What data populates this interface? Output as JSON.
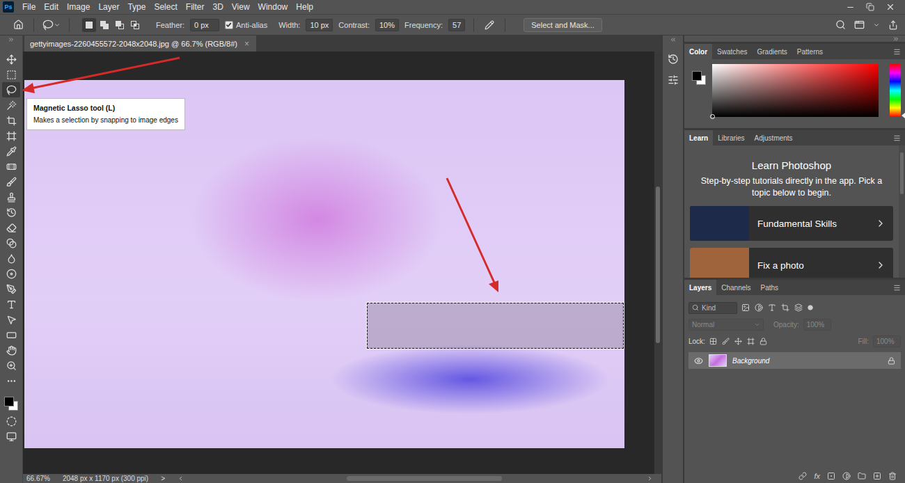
{
  "app": {
    "logo": "Ps"
  },
  "menu": [
    "File",
    "Edit",
    "Image",
    "Layer",
    "Type",
    "Select",
    "Filter",
    "3D",
    "View",
    "Window",
    "Help"
  ],
  "options_bar": {
    "selection_modes": [
      {
        "kind": "new",
        "selected": true
      },
      {
        "kind": "add",
        "selected": false
      },
      {
        "kind": "subtract",
        "selected": false
      },
      {
        "kind": "intersect",
        "selected": false
      }
    ],
    "feather": {
      "label": "Feather:",
      "value": "0 px"
    },
    "anti_alias": {
      "label": "Anti-alias",
      "checked": true
    },
    "settings": [
      {
        "label": "Width:",
        "value": "10 px"
      },
      {
        "label": "Contrast:",
        "value": "10%"
      },
      {
        "label": "Frequency:",
        "value": "57"
      }
    ],
    "select_and_mask": "Select and Mask..."
  },
  "tools": [
    {
      "kind": "move",
      "selected": false
    },
    {
      "kind": "marquee",
      "selected": false
    },
    {
      "kind": "lasso",
      "selected": true
    },
    {
      "kind": "wand",
      "selected": false
    },
    {
      "kind": "crop",
      "selected": false
    },
    {
      "kind": "frame",
      "selected": false
    },
    {
      "kind": "eyedropper",
      "selected": false
    },
    {
      "kind": "healing",
      "selected": false
    },
    {
      "kind": "brush",
      "selected": false
    },
    {
      "kind": "stamp",
      "selected": false
    },
    {
      "kind": "history-brush",
      "selected": false
    },
    {
      "kind": "eraser",
      "selected": false
    },
    {
      "kind": "gradient",
      "selected": false
    },
    {
      "kind": "blur",
      "selected": false
    },
    {
      "kind": "dodge",
      "selected": false
    },
    {
      "kind": "pen",
      "selected": false
    },
    {
      "kind": "type",
      "selected": false
    },
    {
      "kind": "path-select",
      "selected": false
    },
    {
      "kind": "shape",
      "selected": false
    },
    {
      "kind": "hand",
      "selected": false
    },
    {
      "kind": "zoom",
      "selected": false
    },
    {
      "kind": "more",
      "selected": false
    },
    {
      "kind": "colors",
      "selected": false
    },
    {
      "kind": "quick-mask",
      "selected": false
    },
    {
      "kind": "screen-mode",
      "selected": false
    }
  ],
  "tooltip": {
    "title": "Magnetic Lasso tool (L)",
    "description": "Makes a selection by snapping to image edges"
  },
  "document": {
    "tab_title": "gettyimages-2260455572-2048x2048.jpg @ 66.7% (RGB/8#)",
    "close": "×",
    "selection_active": true
  },
  "scrollbars": {
    "vertical": {
      "offset": 0.32,
      "level": 0.37
    },
    "horizontal": {
      "offset": 0.35,
      "level": 0.34
    }
  },
  "status_bar": {
    "zoom": "66.67%",
    "info": "2048 px x 1170 px (300 ppi)",
    "more": ">"
  },
  "color_panel": {
    "tabs": [
      {
        "label": "Color",
        "selected": true
      },
      {
        "label": "Swatches",
        "selected": false
      },
      {
        "label": "Gradients",
        "selected": false
      },
      {
        "label": "Patterns",
        "selected": false
      }
    ]
  },
  "learn_panel": {
    "tabs": [
      {
        "label": "Learn",
        "selected": true
      },
      {
        "label": "Libraries",
        "selected": false
      },
      {
        "label": "Adjustments",
        "selected": false
      }
    ],
    "heading": "Learn Photoshop",
    "text": "Step-by-step tutorials directly in the app. Pick a topic below to begin.",
    "topics": [
      "Fundamental Skills",
      "Fix a photo"
    ]
  },
  "layers_panel": {
    "tabs": [
      {
        "label": "Layers",
        "selected": true
      },
      {
        "label": "Channels",
        "selected": false
      },
      {
        "label": "Paths",
        "selected": false
      }
    ],
    "filter": {
      "placeholder": "Kind"
    },
    "blend_mode": {
      "value": "Normal",
      "disabled": true
    },
    "opacity": {
      "label": "Opacity:",
      "value": "100%",
      "disabled": true
    },
    "lock_label": "Lock:",
    "fill": {
      "label": "Fill:",
      "value": "100%",
      "disabled": true
    },
    "layers": [
      {
        "name": "Background",
        "visible": true,
        "locked": true,
        "selected": true
      }
    ],
    "footer_fx": "fx"
  }
}
